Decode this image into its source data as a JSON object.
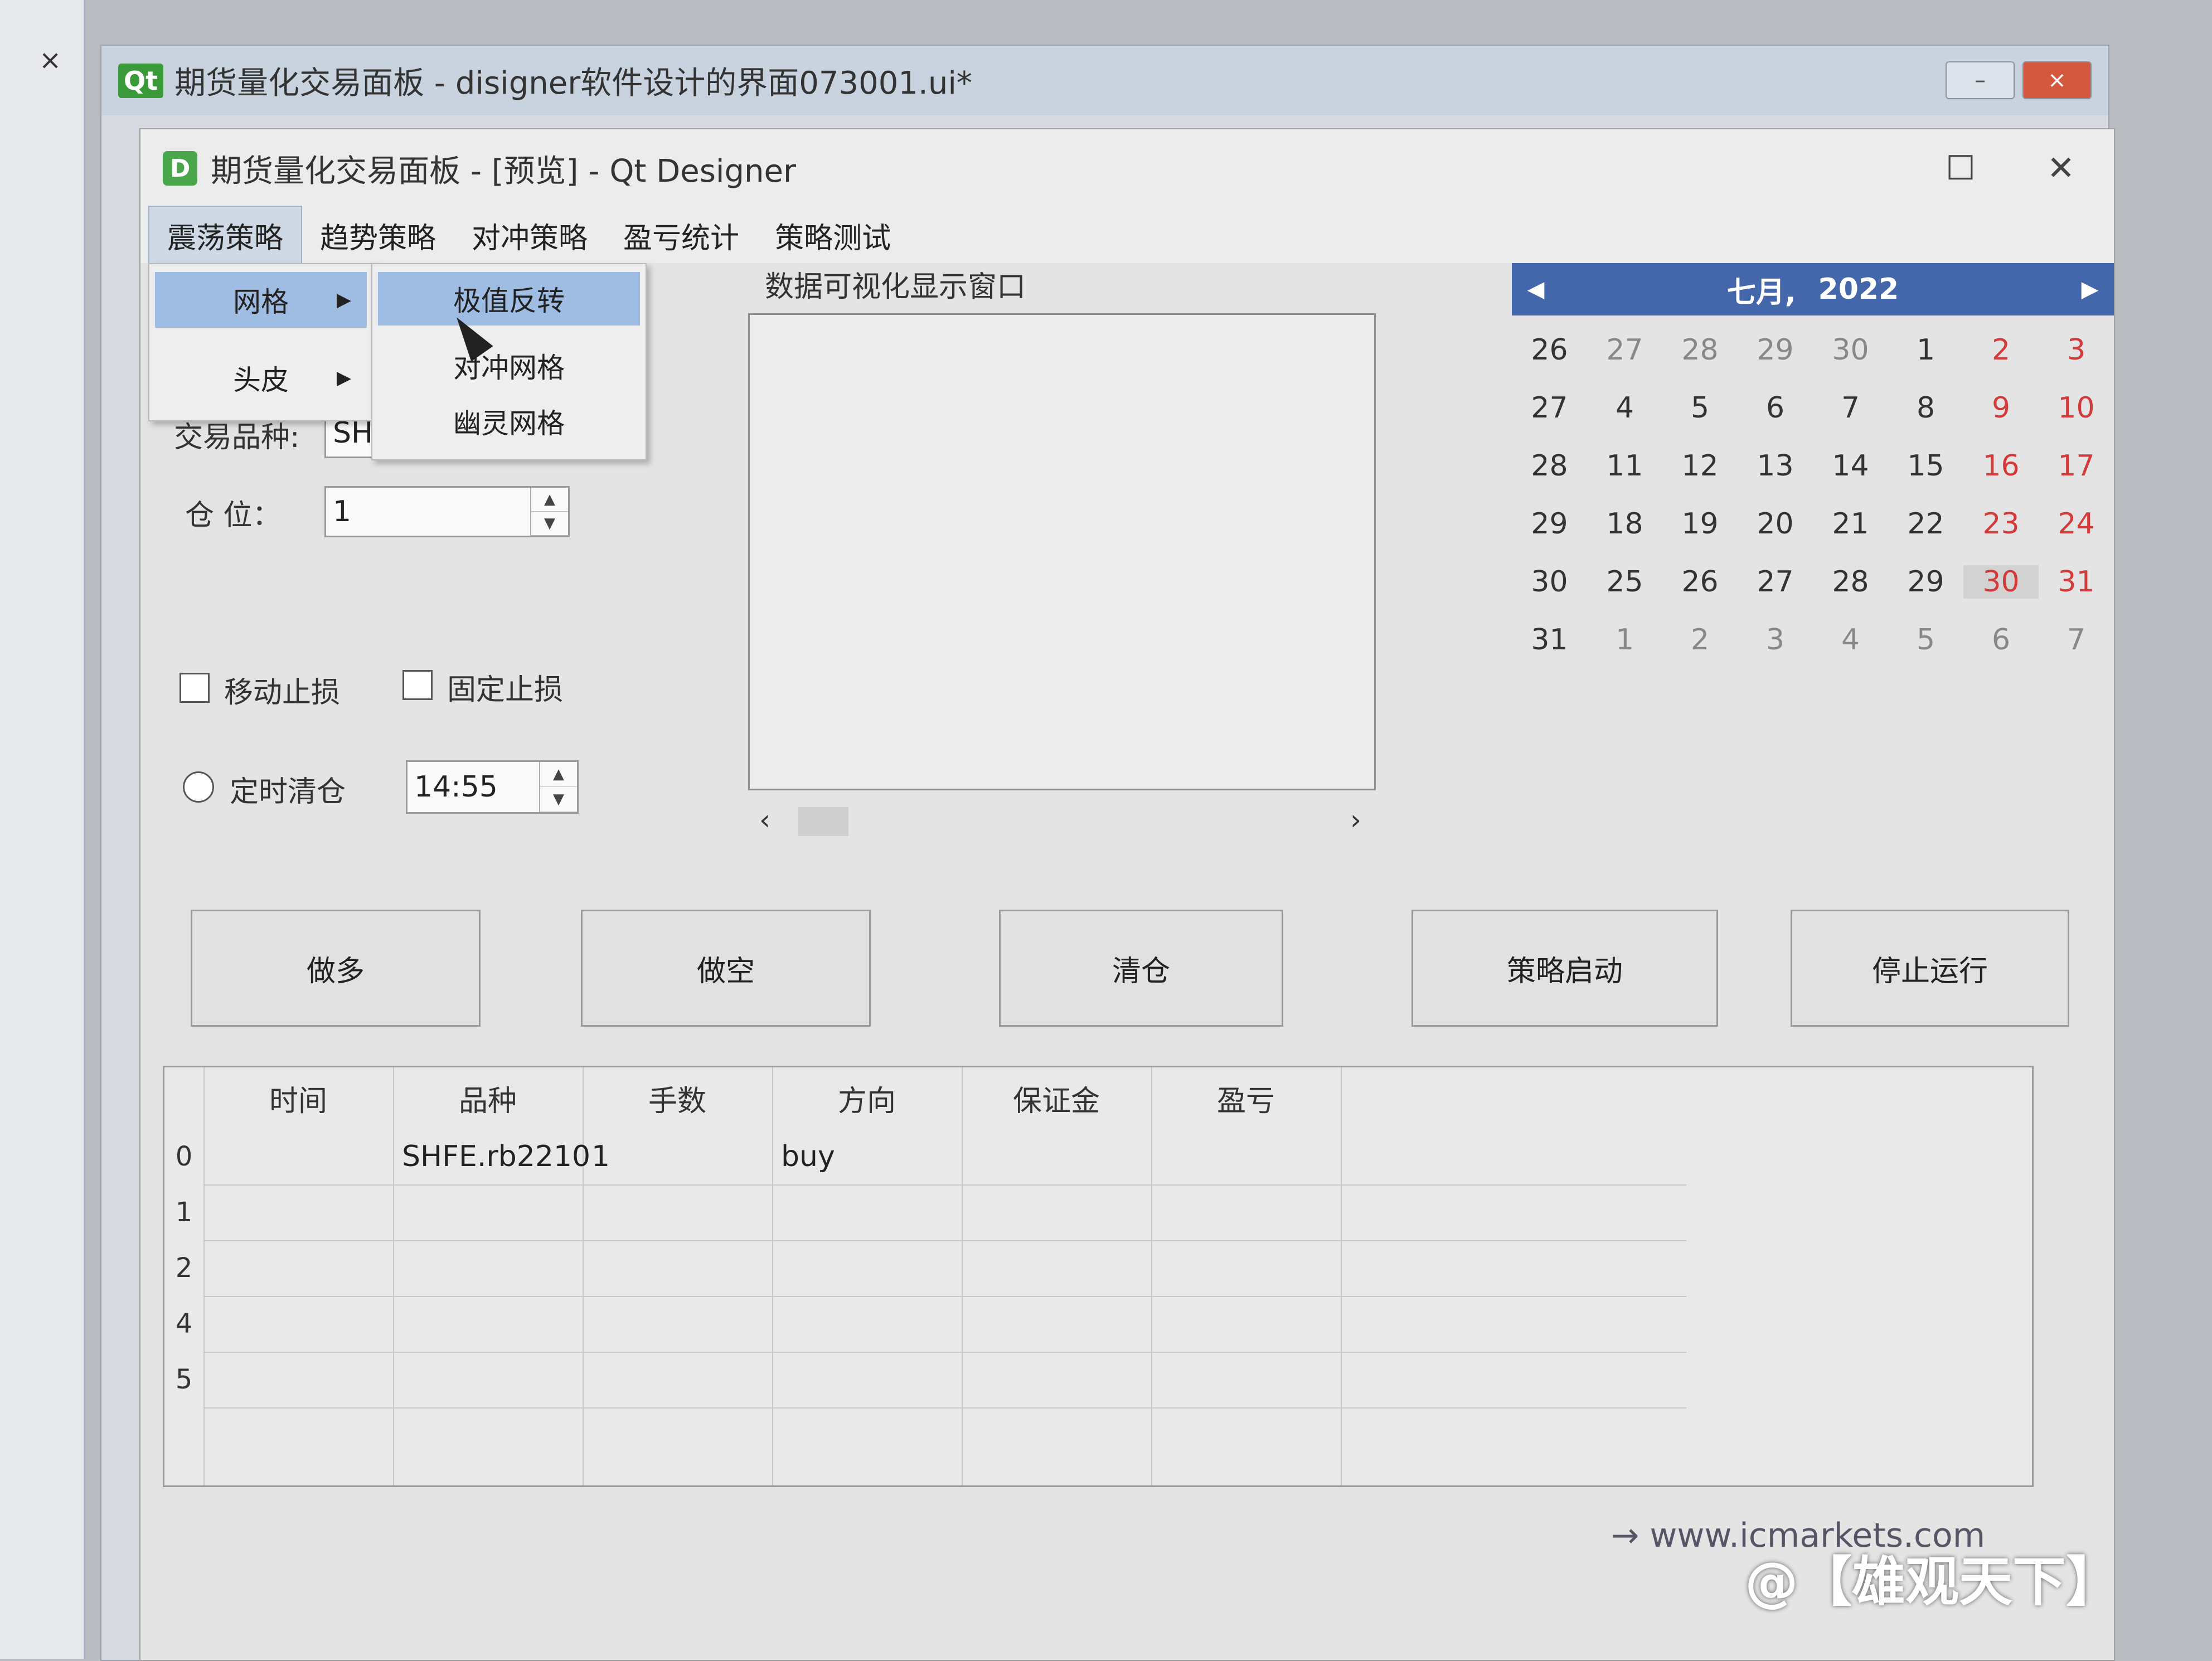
{
  "back_window": {
    "title": "期货量化交易面板 - disigner软件设计的界面073001.ui*",
    "badge": "Qt",
    "min_label": "–",
    "close_label": "×",
    "side_close": "×"
  },
  "preview": {
    "title": "期货量化交易面板 - [预览] - Qt Designer",
    "icon_letter": "D",
    "maximize": "☐",
    "close": "✕"
  },
  "menu": [
    "震荡策略",
    "趋势策略",
    "对冲策略",
    "盈亏统计",
    "策略测试"
  ],
  "dropdown": {
    "items": [
      "网格",
      "头皮"
    ],
    "arrow": "▶",
    "submenu": [
      "极值反转",
      "对冲网格",
      "幽灵网格"
    ]
  },
  "form": {
    "symbol_label": "交易品种:",
    "symbol_value": "SH",
    "position_label": "仓  位：",
    "position_value": "1",
    "trailing_stop": "移动止损",
    "fixed_stop": "固定止损",
    "timed_close": "定时清仓",
    "time_value": "14:55",
    "spin_up": "▲",
    "spin_down": "▼"
  },
  "viz": {
    "title": "数据可视化显示窗口",
    "scroll_left": "‹",
    "scroll_right": "›"
  },
  "calendar": {
    "month": "七月,",
    "year": "2022",
    "prev": "◀",
    "next": "▶",
    "rows": [
      [
        "26",
        "27",
        "28",
        "29",
        "30",
        "1",
        "2",
        "3"
      ],
      [
        "27",
        "4",
        "5",
        "6",
        "7",
        "8",
        "9",
        "10"
      ],
      [
        "28",
        "11",
        "12",
        "13",
        "14",
        "15",
        "16",
        "17"
      ],
      [
        "29",
        "18",
        "19",
        "20",
        "21",
        "22",
        "23",
        "24"
      ],
      [
        "30",
        "25",
        "26",
        "27",
        "28",
        "29",
        "30",
        "31"
      ],
      [
        "31",
        "1",
        "2",
        "3",
        "4",
        "5",
        "6",
        "7"
      ]
    ]
  },
  "buttons": [
    "做多",
    "做空",
    "清仓",
    "策略启动",
    "停止运行"
  ],
  "table": {
    "headers": [
      "时间",
      "品种",
      "手数",
      "方向",
      "保证金",
      "盈亏"
    ],
    "row_labels": [
      "0",
      "1",
      "2",
      "4",
      "5"
    ],
    "rows": [
      [
        "",
        "SHFE.rb2210",
        "1",
        "buy",
        "",
        ""
      ]
    ]
  },
  "footer": {
    "link": "→ www.icmarkets.com",
    "watermark": "@【雄观天下】"
  },
  "colors": {
    "menu_highlight": "#9fbde3",
    "calendar_header": "#4466aa",
    "weekend_red": "#d43a3a"
  }
}
